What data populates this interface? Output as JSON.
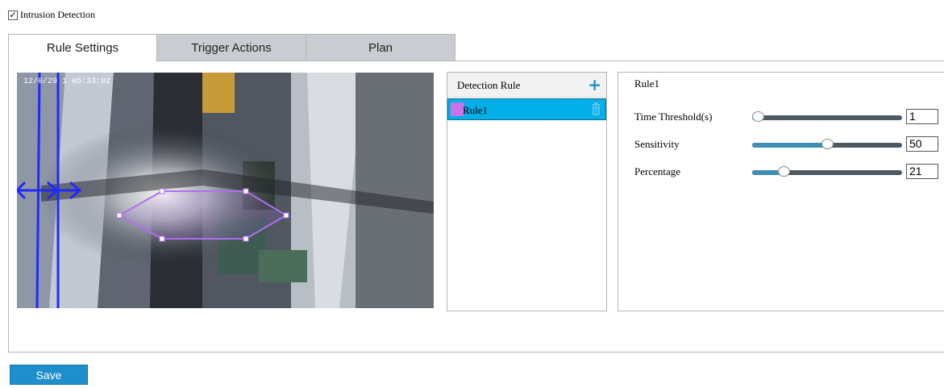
{
  "feature": {
    "label": "Intrusion Detection",
    "checked": true
  },
  "tabs": [
    {
      "label": "Rule Settings",
      "active": true
    },
    {
      "label": "Trigger Actions",
      "active": false
    },
    {
      "label": "Plan",
      "active": false
    }
  ],
  "video": {
    "timestamp": "12/0/29 1 05:33:02"
  },
  "rule_list": {
    "header": "Detection Rule",
    "add_icon": "plus-icon",
    "delete_icon": "trash-icon",
    "items": [
      {
        "label": "Rule1",
        "color": "#c974e6",
        "selected": true
      }
    ]
  },
  "rule_props": {
    "title": "Rule1",
    "fields": [
      {
        "label": "Time Threshold(s)",
        "value": "1",
        "level": 0.0
      },
      {
        "label": "Sensitivity",
        "value": "50",
        "level": 0.5
      },
      {
        "label": "Percentage",
        "value": "21",
        "level": 0.21
      }
    ]
  },
  "colors": {
    "accent": "#1e8fcc",
    "selection": "#00aee8",
    "region": "#b06ef0"
  },
  "save_label": "Save"
}
